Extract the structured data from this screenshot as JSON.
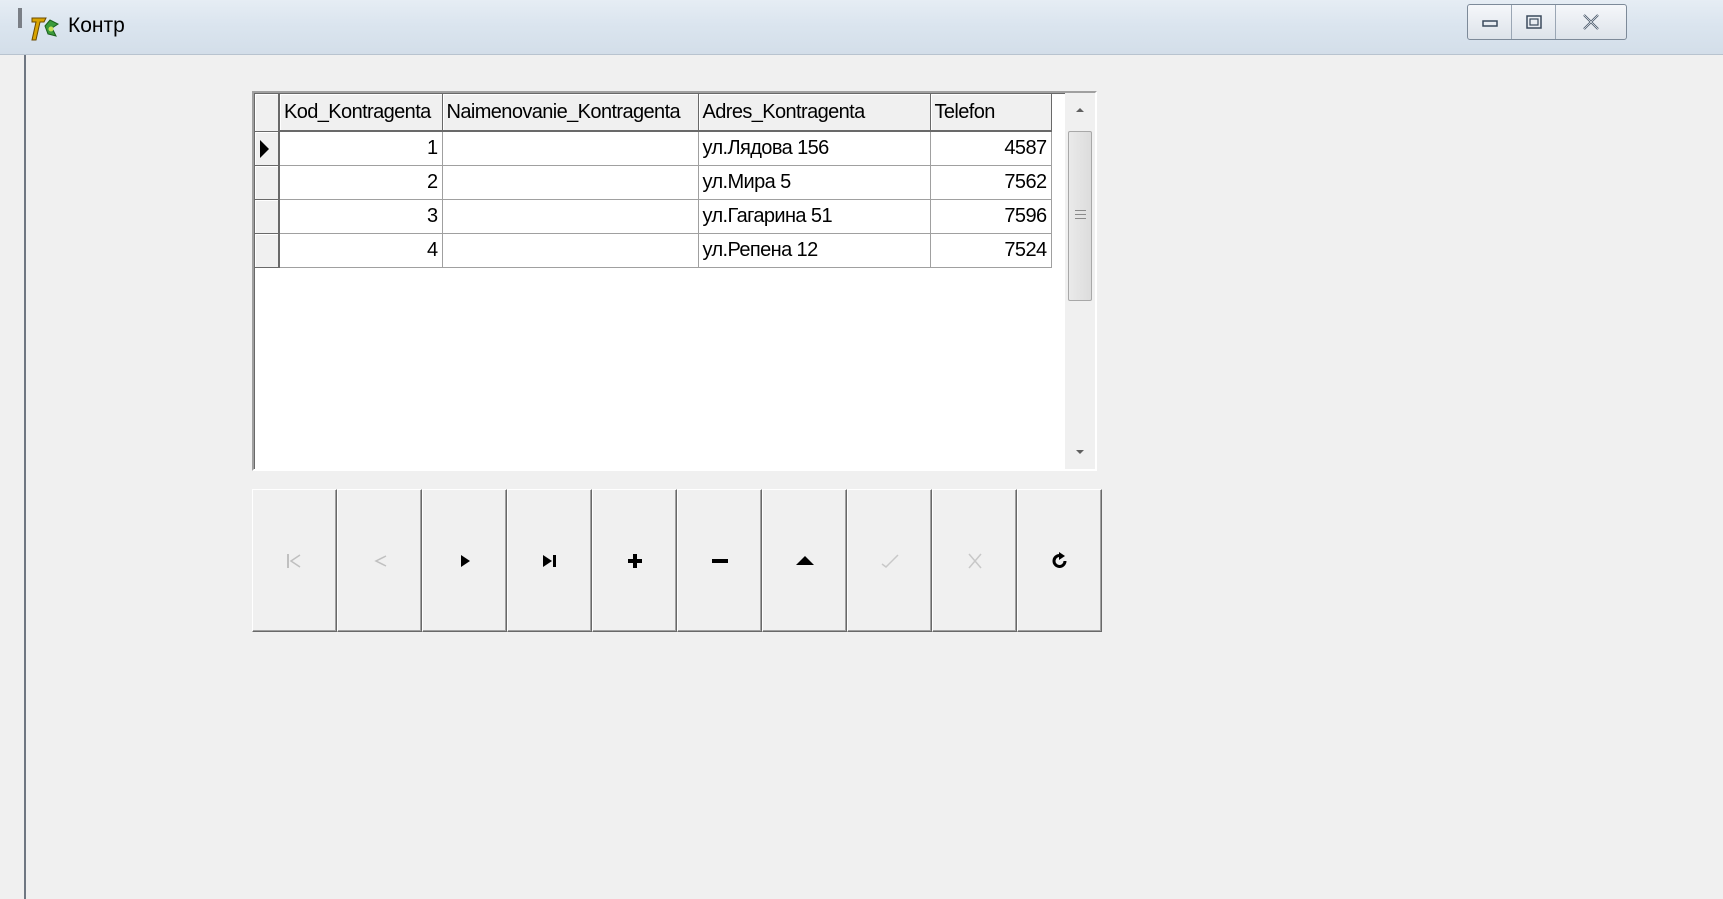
{
  "window": {
    "title": "Контр",
    "icons": {
      "app": "delphi-app-icon",
      "minimize": "minimize-icon",
      "maximize": "maximize-icon",
      "close": "close-icon"
    }
  },
  "grid": {
    "columns": [
      "Kod_Kontragenta",
      "Naimenovanie_Kontragenta",
      "Adres_Kontragenta",
      "Telefon"
    ],
    "rows": [
      {
        "kod": "1",
        "naim": "",
        "adres": "ул.Лядова 156",
        "telefon": "4587",
        "current": true
      },
      {
        "kod": "2",
        "naim": "",
        "adres": "ул.Мира 5",
        "telefon": "7562",
        "current": false
      },
      {
        "kod": "3",
        "naim": "",
        "adres": "ул.Гагарина 51",
        "telefon": "7596",
        "current": false
      },
      {
        "kod": "4",
        "naim": "",
        "adres": "ул.Репена 12",
        "telefon": "7524",
        "current": false
      }
    ]
  },
  "navigator": {
    "buttons": [
      {
        "name": "first-record",
        "icon": "first-icon",
        "enabled": false
      },
      {
        "name": "prior-record",
        "icon": "prior-icon",
        "enabled": false
      },
      {
        "name": "next-record",
        "icon": "next-icon",
        "enabled": true
      },
      {
        "name": "last-record",
        "icon": "last-icon",
        "enabled": true
      },
      {
        "name": "insert-record",
        "icon": "plus-icon",
        "enabled": true
      },
      {
        "name": "delete-record",
        "icon": "minus-icon",
        "enabled": true
      },
      {
        "name": "edit-record",
        "icon": "edit-icon",
        "enabled": true
      },
      {
        "name": "post-edit",
        "icon": "check-icon",
        "enabled": false
      },
      {
        "name": "cancel-edit",
        "icon": "cancel-icon",
        "enabled": false
      },
      {
        "name": "refresh-data",
        "icon": "refresh-icon",
        "enabled": true
      }
    ]
  }
}
